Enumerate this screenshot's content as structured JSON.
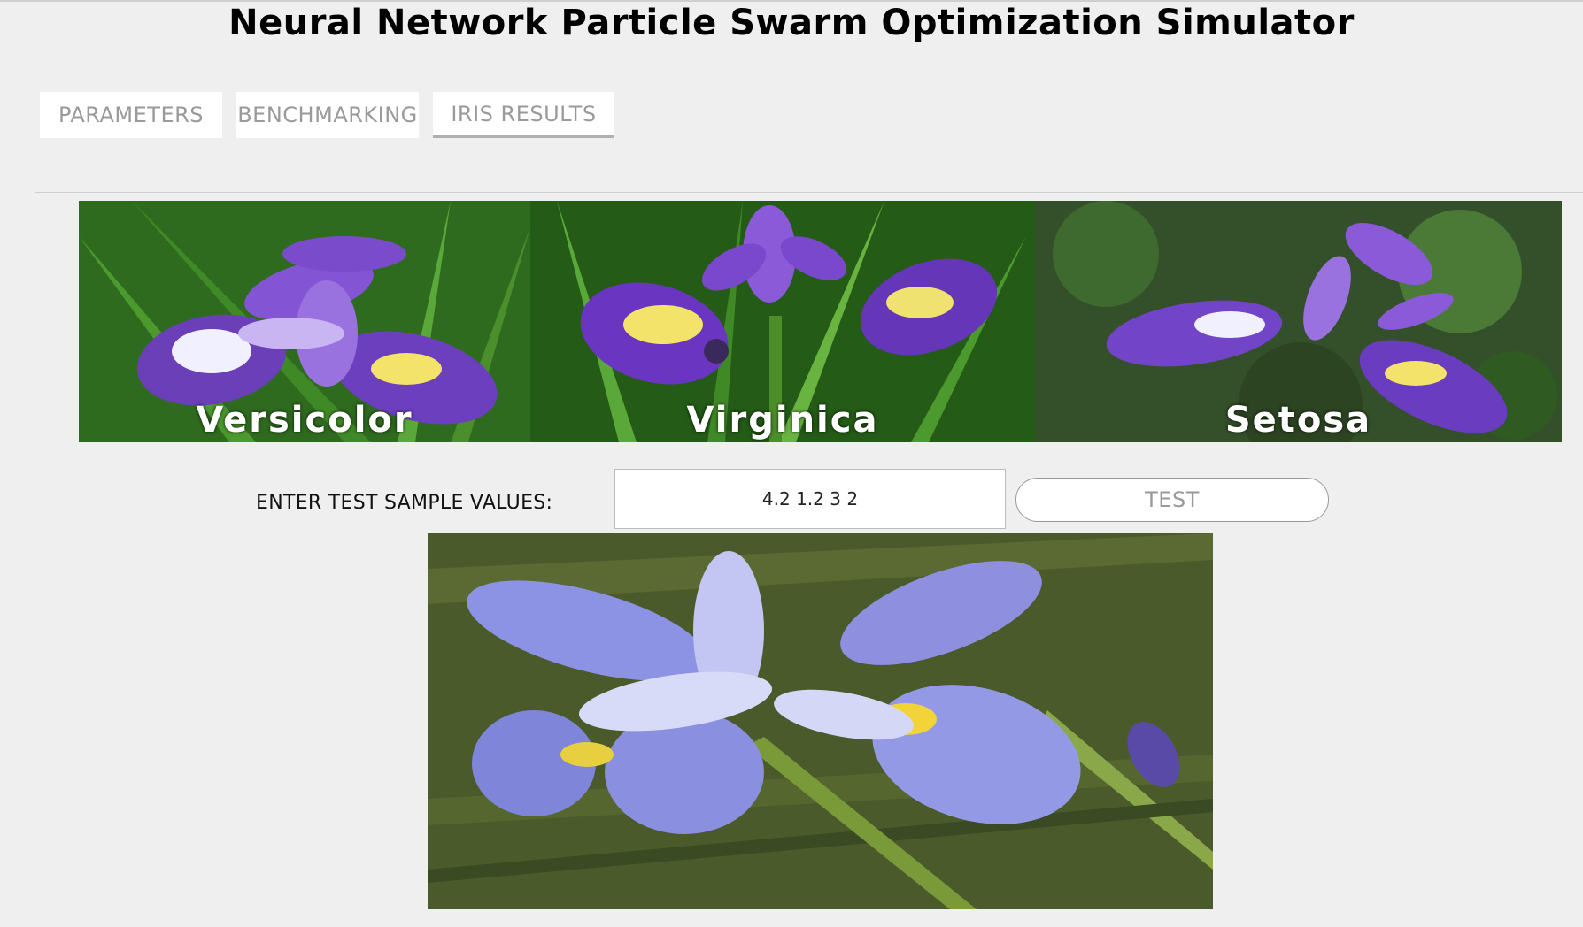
{
  "page": {
    "title": "Neural Network Particle Swarm Optimization Simulator"
  },
  "tabs": [
    {
      "label": "PARAMETERS",
      "active": false
    },
    {
      "label": "BENCHMARKING",
      "active": false
    },
    {
      "label": "IRIS RESULTS",
      "active": true
    }
  ],
  "banner": {
    "flowers": [
      {
        "label": "Versicolor"
      },
      {
        "label": "Virginica"
      },
      {
        "label": "Setosa"
      }
    ]
  },
  "test": {
    "label": "ENTER TEST SAMPLE VALUES:",
    "input_value": "4.2 1.2 3 2",
    "button_label": "TEST"
  },
  "colors": {
    "background": "#efefef",
    "tab_text": "#9a9a9a",
    "petal_purple": "#7b48c8",
    "petal_light": "#8f8fe0",
    "foliage": "#2f6b1f"
  }
}
